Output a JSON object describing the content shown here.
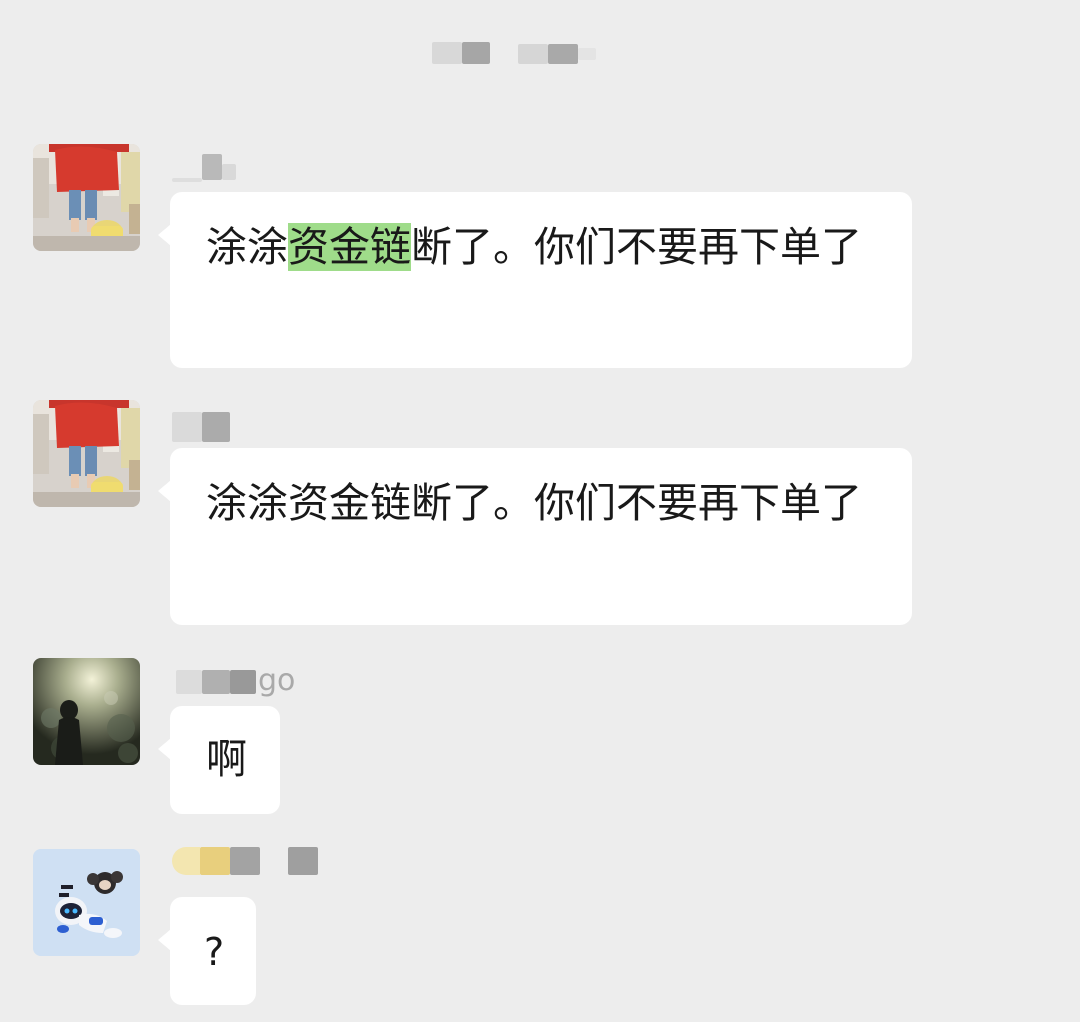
{
  "colors": {
    "background": "#ededed",
    "bubble": "#ffffff",
    "text": "#191919",
    "sender": "#a9a9a9",
    "highlight": "#9fdc8a"
  },
  "messages": [
    {
      "avatar": "avatar-girl-red-shirt",
      "sender": "",
      "text_parts": [
        "涂涂",
        "资金链",
        "断了。你们不要再下单了"
      ],
      "highlighted_part": "资金链"
    },
    {
      "avatar": "avatar-girl-red-shirt",
      "sender": "",
      "text": "涂涂资金链断了。你们不要再下单了"
    },
    {
      "avatar": "avatar-forest-silhouette",
      "sender_suffix": "go",
      "text": "啊"
    },
    {
      "avatar": "avatar-astro-robot",
      "sender": "",
      "text": "?"
    }
  ]
}
